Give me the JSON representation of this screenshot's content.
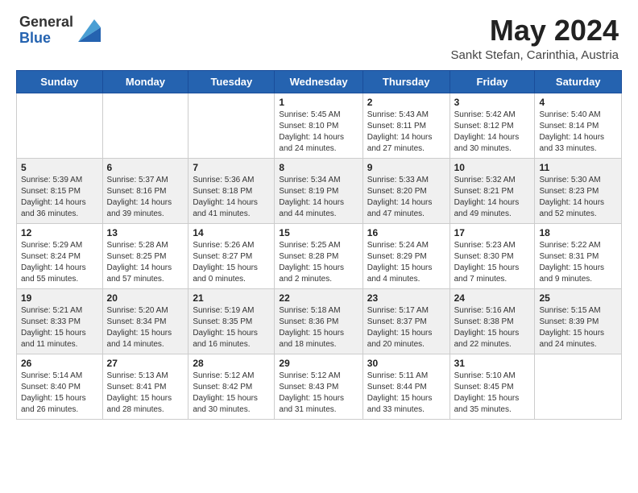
{
  "header": {
    "logo_general": "General",
    "logo_blue": "Blue",
    "month_year": "May 2024",
    "location": "Sankt Stefan, Carinthia, Austria"
  },
  "days_of_week": [
    "Sunday",
    "Monday",
    "Tuesday",
    "Wednesday",
    "Thursday",
    "Friday",
    "Saturday"
  ],
  "weeks": [
    [
      {
        "day": "",
        "info": ""
      },
      {
        "day": "",
        "info": ""
      },
      {
        "day": "",
        "info": ""
      },
      {
        "day": "1",
        "info": "Sunrise: 5:45 AM\nSunset: 8:10 PM\nDaylight: 14 hours\nand 24 minutes."
      },
      {
        "day": "2",
        "info": "Sunrise: 5:43 AM\nSunset: 8:11 PM\nDaylight: 14 hours\nand 27 minutes."
      },
      {
        "day": "3",
        "info": "Sunrise: 5:42 AM\nSunset: 8:12 PM\nDaylight: 14 hours\nand 30 minutes."
      },
      {
        "day": "4",
        "info": "Sunrise: 5:40 AM\nSunset: 8:14 PM\nDaylight: 14 hours\nand 33 minutes."
      }
    ],
    [
      {
        "day": "5",
        "info": "Sunrise: 5:39 AM\nSunset: 8:15 PM\nDaylight: 14 hours\nand 36 minutes."
      },
      {
        "day": "6",
        "info": "Sunrise: 5:37 AM\nSunset: 8:16 PM\nDaylight: 14 hours\nand 39 minutes."
      },
      {
        "day": "7",
        "info": "Sunrise: 5:36 AM\nSunset: 8:18 PM\nDaylight: 14 hours\nand 41 minutes."
      },
      {
        "day": "8",
        "info": "Sunrise: 5:34 AM\nSunset: 8:19 PM\nDaylight: 14 hours\nand 44 minutes."
      },
      {
        "day": "9",
        "info": "Sunrise: 5:33 AM\nSunset: 8:20 PM\nDaylight: 14 hours\nand 47 minutes."
      },
      {
        "day": "10",
        "info": "Sunrise: 5:32 AM\nSunset: 8:21 PM\nDaylight: 14 hours\nand 49 minutes."
      },
      {
        "day": "11",
        "info": "Sunrise: 5:30 AM\nSunset: 8:23 PM\nDaylight: 14 hours\nand 52 minutes."
      }
    ],
    [
      {
        "day": "12",
        "info": "Sunrise: 5:29 AM\nSunset: 8:24 PM\nDaylight: 14 hours\nand 55 minutes."
      },
      {
        "day": "13",
        "info": "Sunrise: 5:28 AM\nSunset: 8:25 PM\nDaylight: 14 hours\nand 57 minutes."
      },
      {
        "day": "14",
        "info": "Sunrise: 5:26 AM\nSunset: 8:27 PM\nDaylight: 15 hours\nand 0 minutes."
      },
      {
        "day": "15",
        "info": "Sunrise: 5:25 AM\nSunset: 8:28 PM\nDaylight: 15 hours\nand 2 minutes."
      },
      {
        "day": "16",
        "info": "Sunrise: 5:24 AM\nSunset: 8:29 PM\nDaylight: 15 hours\nand 4 minutes."
      },
      {
        "day": "17",
        "info": "Sunrise: 5:23 AM\nSunset: 8:30 PM\nDaylight: 15 hours\nand 7 minutes."
      },
      {
        "day": "18",
        "info": "Sunrise: 5:22 AM\nSunset: 8:31 PM\nDaylight: 15 hours\nand 9 minutes."
      }
    ],
    [
      {
        "day": "19",
        "info": "Sunrise: 5:21 AM\nSunset: 8:33 PM\nDaylight: 15 hours\nand 11 minutes."
      },
      {
        "day": "20",
        "info": "Sunrise: 5:20 AM\nSunset: 8:34 PM\nDaylight: 15 hours\nand 14 minutes."
      },
      {
        "day": "21",
        "info": "Sunrise: 5:19 AM\nSunset: 8:35 PM\nDaylight: 15 hours\nand 16 minutes."
      },
      {
        "day": "22",
        "info": "Sunrise: 5:18 AM\nSunset: 8:36 PM\nDaylight: 15 hours\nand 18 minutes."
      },
      {
        "day": "23",
        "info": "Sunrise: 5:17 AM\nSunset: 8:37 PM\nDaylight: 15 hours\nand 20 minutes."
      },
      {
        "day": "24",
        "info": "Sunrise: 5:16 AM\nSunset: 8:38 PM\nDaylight: 15 hours\nand 22 minutes."
      },
      {
        "day": "25",
        "info": "Sunrise: 5:15 AM\nSunset: 8:39 PM\nDaylight: 15 hours\nand 24 minutes."
      }
    ],
    [
      {
        "day": "26",
        "info": "Sunrise: 5:14 AM\nSunset: 8:40 PM\nDaylight: 15 hours\nand 26 minutes."
      },
      {
        "day": "27",
        "info": "Sunrise: 5:13 AM\nSunset: 8:41 PM\nDaylight: 15 hours\nand 28 minutes."
      },
      {
        "day": "28",
        "info": "Sunrise: 5:12 AM\nSunset: 8:42 PM\nDaylight: 15 hours\nand 30 minutes."
      },
      {
        "day": "29",
        "info": "Sunrise: 5:12 AM\nSunset: 8:43 PM\nDaylight: 15 hours\nand 31 minutes."
      },
      {
        "day": "30",
        "info": "Sunrise: 5:11 AM\nSunset: 8:44 PM\nDaylight: 15 hours\nand 33 minutes."
      },
      {
        "day": "31",
        "info": "Sunrise: 5:10 AM\nSunset: 8:45 PM\nDaylight: 15 hours\nand 35 minutes."
      },
      {
        "day": "",
        "info": ""
      }
    ]
  ]
}
